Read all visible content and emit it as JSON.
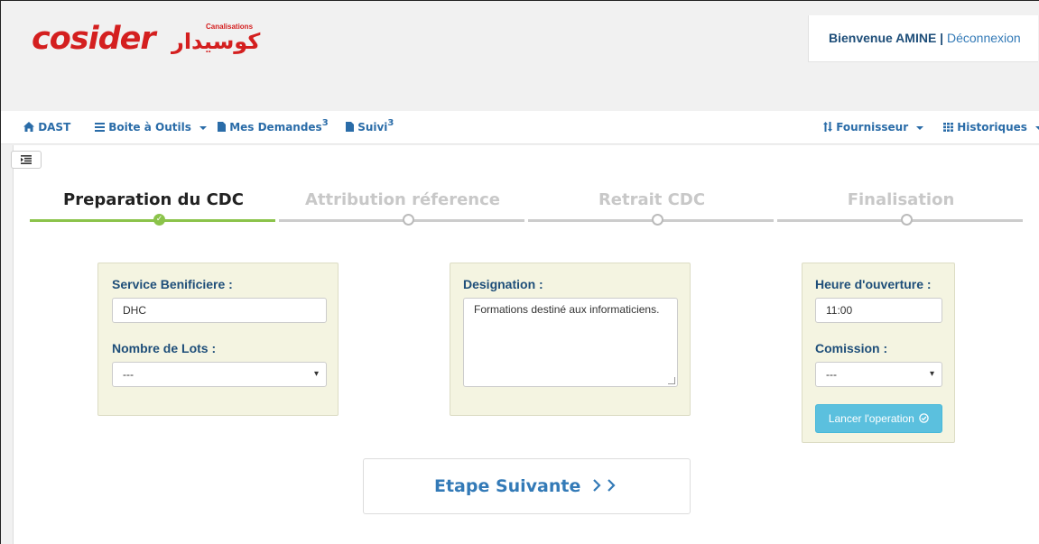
{
  "brand": {
    "logo_latin": "cosider",
    "logo_arabic": "كوسيدار",
    "logo_sub": "Canalisations",
    "color": "#d41f1f"
  },
  "user": {
    "welcome": "Bienvenue AMINE |",
    "logout": "Déconnexion"
  },
  "nav": {
    "dast": "DAST",
    "outils": "Boite à Outils",
    "demandes": "Mes Demandes",
    "demandes_count": "3",
    "suivi": "Suivi",
    "suivi_count": "3",
    "fournisseur": "Fournisseur",
    "historiques": "Historiques"
  },
  "steps": [
    {
      "label": "Preparation du CDC",
      "state": "done"
    },
    {
      "label": "Attribution réference",
      "state": "pending"
    },
    {
      "label": "Retrait CDC",
      "state": "pending"
    },
    {
      "label": "Finalisation",
      "state": "pending"
    }
  ],
  "form": {
    "service_label": "Service Benificiere :",
    "service_value": "DHC",
    "lots_label": "Nombre de Lots :",
    "lots_value": "---",
    "designation_label": "Designation :",
    "designation_value": "Formations destiné aux informaticiens.",
    "heure_label": "Heure d'ouverture :",
    "heure_value": "11:00",
    "comission_label": "Comission :",
    "comission_value": "---",
    "launch_button": "Lancer l'operation"
  },
  "next_button": "Etape Suivante",
  "colors": {
    "accent": "#337ab7",
    "done": "#8bc34a",
    "panel": "#f4f4e1",
    "label": "#1e4e79",
    "info_button": "#5bc0de"
  }
}
